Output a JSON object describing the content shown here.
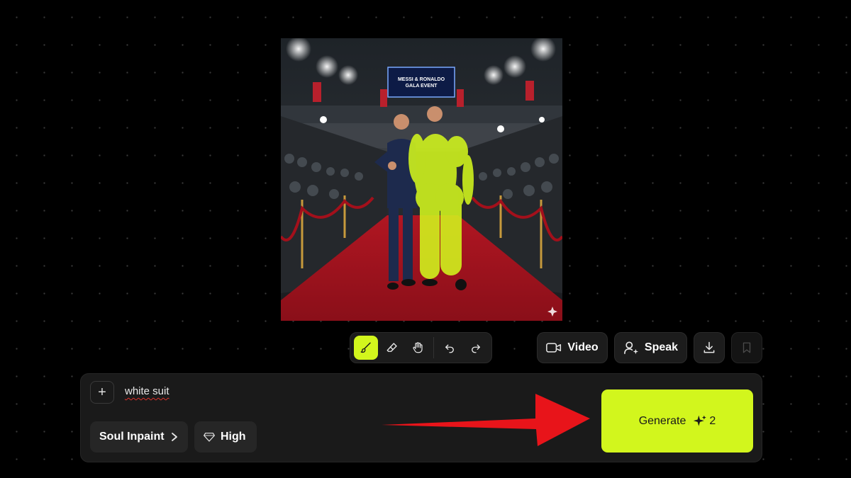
{
  "image": {
    "alt_icon": "sparkle-watermark-icon",
    "sign_line1": "MESSI & RONALDO",
    "sign_line2": "GALA EVENT",
    "mask_color": "#d2f61d"
  },
  "brush_toolbar": {
    "tools": [
      "brush-icon",
      "eraser-icon",
      "hand-icon",
      "undo-icon",
      "redo-icon"
    ],
    "active_tool": "brush-icon"
  },
  "actions": {
    "video_label": "Video",
    "speak_label": "Speak",
    "download_icon": "download-icon",
    "save_icon": "bookmark-icon"
  },
  "prompt": {
    "add_label": "+",
    "text": "white suit",
    "model_label": "Soul Inpaint",
    "quality_label": "High",
    "generate_label": "Generate",
    "credit_cost": "2"
  },
  "colors": {
    "accent": "#d2f61d",
    "background": "#000000",
    "panel": "#1a1a1a",
    "annotation_arrow": "#e8141a"
  }
}
